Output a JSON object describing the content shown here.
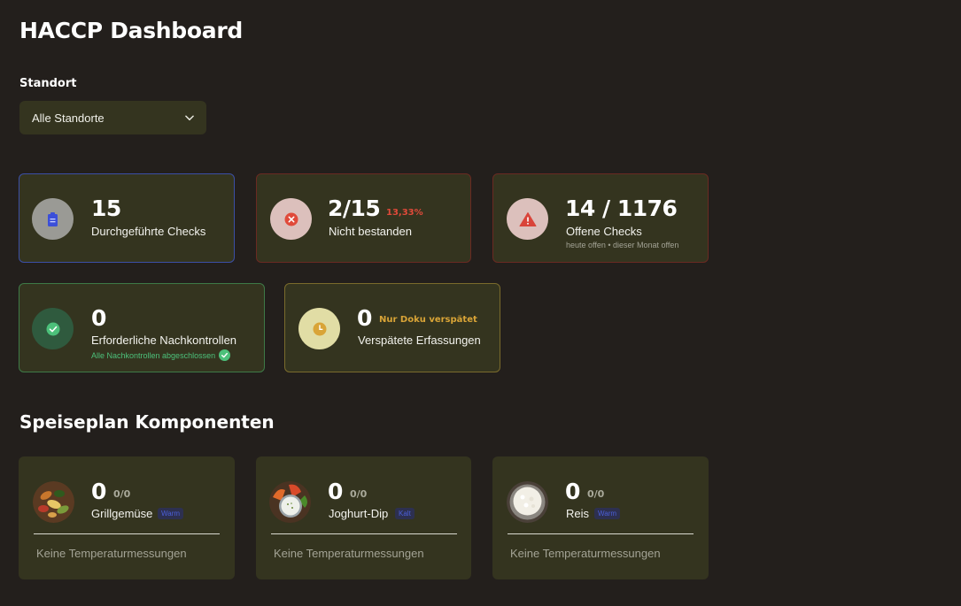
{
  "header": {
    "title": "HACCP Dashboard"
  },
  "location": {
    "label": "Standort",
    "selected": "Alle Standorte"
  },
  "stats": {
    "checks": {
      "value": "15",
      "label": "Durchgeführte Checks",
      "icon": "clipboard-icon",
      "color": "#3b4fd8"
    },
    "failed": {
      "value": "2/15",
      "percent": "13,33%",
      "label": "Nicht bestanden",
      "icon": "x-circle-icon",
      "color": "#e04a3a"
    },
    "open": {
      "value": "14 / 1176",
      "label": "Offene Checks",
      "sub": "heute offen • dieser Monat offen",
      "icon": "warning-icon",
      "color": "#d9443a"
    },
    "followups": {
      "value": "0",
      "label": "Erforderliche Nachkontrollen",
      "sub": "Alle Nachkontrollen abgeschlossen",
      "icon": "check-icon",
      "color": "#4cc07a"
    },
    "late": {
      "value": "0",
      "note": "Nur Doku verspätet",
      "label": "Verspätete Erfassungen",
      "icon": "clock-icon",
      "color": "#d9a437"
    }
  },
  "menu": {
    "title": "Speiseplan Komponenten",
    "items": [
      {
        "value": "0",
        "count": "0/0",
        "name": "Grillgemüse",
        "badge": "Warm",
        "empty": "Keine Temperaturmessungen"
      },
      {
        "value": "0",
        "count": "0/0",
        "name": "Joghurt-Dip",
        "badge": "Kalt",
        "empty": "Keine Temperaturmessungen"
      },
      {
        "value": "0",
        "count": "0/0",
        "name": "Reis",
        "badge": "Warm",
        "empty": "Keine Temperaturmessungen"
      }
    ]
  }
}
